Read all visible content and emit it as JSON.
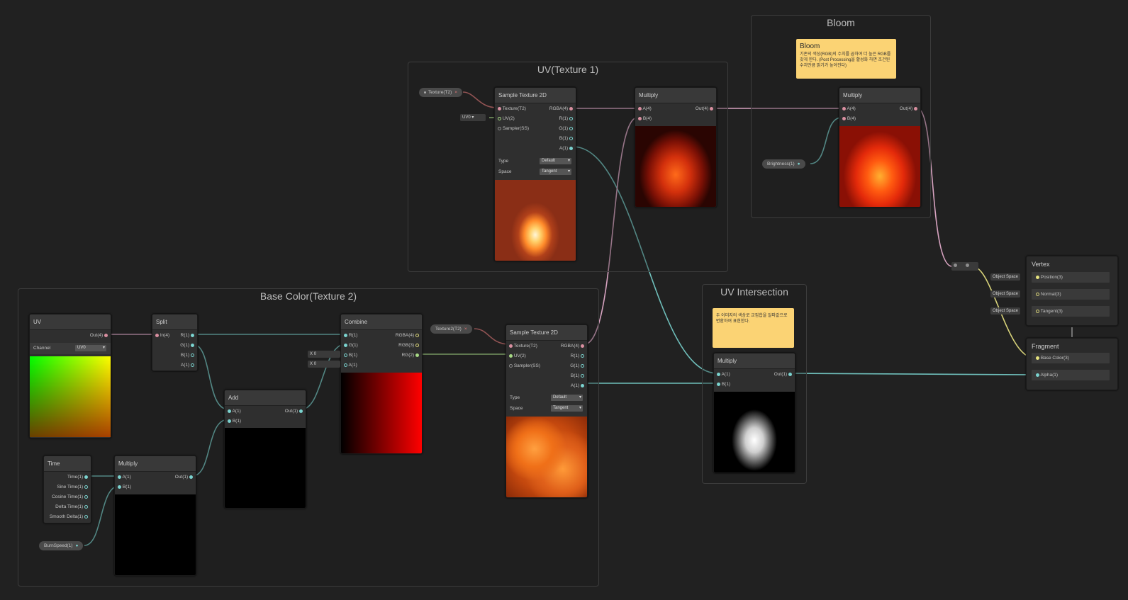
{
  "groups": {
    "uv_tex1": "UV(Texture 1)",
    "bloom": "Bloom",
    "base_color": "Base Color(Texture 2)",
    "uv_intersection": "UV Intersection"
  },
  "sticky_bloom": {
    "title": "Bloom",
    "text": "기존의 색상(RGB)의 수치를 곱하여 더 높은 RGB를 갖게 한다. (Post Processing을 활성화 하면 조건된 수치만큼 밝기가 높아진다)"
  },
  "sticky_uv": {
    "text": "두 이미지의 색상로 교집합을 알파값으로 변환하여 표현한다."
  },
  "props": {
    "texture1": "Texture(T2)",
    "texture2": "Texture2(T2)",
    "brightness": "Brightness(1)",
    "burn_speed": "BurnSpeed(1)",
    "uv0": "UV0"
  },
  "sample1": {
    "title": "Sample Texture 2D",
    "in_texture": "Texture(T2)",
    "in_uv": "UV(2)",
    "in_sampler": "Sampler(SS)",
    "out_rgba": "RGBA(4)",
    "out_r": "R(1)",
    "out_g": "G(1)",
    "out_b": "B(1)",
    "out_a": "A(1)",
    "type_label": "Type",
    "type_value": "Default",
    "space_label": "Space",
    "space_value": "Tangent"
  },
  "multiply1": {
    "title": "Multiply",
    "a": "A(4)",
    "b": "B(4)",
    "out": "Out(4)"
  },
  "multiply2": {
    "title": "Multiply",
    "a": "A(4)",
    "b": "B(4)",
    "out": "Out(4)"
  },
  "uv_node": {
    "title": "UV",
    "out": "Out(4)",
    "channel_label": "Channel",
    "channel_value": "UV0"
  },
  "split": {
    "title": "Split",
    "in": "In(4)",
    "r": "R(1)",
    "g": "G(1)",
    "b": "B(1)",
    "a": "A(1)"
  },
  "combine": {
    "title": "Combine",
    "r": "R(1)",
    "g": "G(1)",
    "b": "B(1)",
    "a": "A(1)",
    "rgba": "RGBA(4)",
    "rgb": "RGB(3)",
    "rg": "RG(2)",
    "b_default": "0",
    "a_default": "0",
    "x_label": "X"
  },
  "add": {
    "title": "Add",
    "a": "A(1)",
    "b": "B(1)",
    "out": "Out(1)"
  },
  "time": {
    "title": "Time",
    "time": "Time(1)",
    "sine": "Sine Time(1)",
    "cosine": "Cosine Time(1)",
    "delta": "Delta Time(1)",
    "smooth": "Smooth Delta(1)"
  },
  "multiply3": {
    "title": "Multiply",
    "a": "A(1)",
    "b": "B(1)",
    "out": "Out(1)"
  },
  "sample2": {
    "title": "Sample Texture 2D",
    "in_texture": "Texture(T2)",
    "in_uv": "UV(2)",
    "in_sampler": "Sampler(SS)",
    "out_rgba": "RGBA(4)",
    "out_r": "R(1)",
    "out_g": "G(1)",
    "out_b": "B(1)",
    "out_a": "A(1)",
    "type_label": "Type",
    "type_value": "Default",
    "space_label": "Space",
    "space_value": "Tangent"
  },
  "multiply4": {
    "title": "Multiply",
    "a": "A(1)",
    "b": "B(1)",
    "out": "Out(1)"
  },
  "vertex": {
    "title": "Vertex",
    "position": "Position(3)",
    "normal": "Normal(3)",
    "tangent": "Tangent(3)",
    "space": "Object Space"
  },
  "fragment": {
    "title": "Fragment",
    "base_color": "Base Color(3)",
    "alpha": "Alpha(1)"
  },
  "colors": {
    "background": "#212121",
    "wire_pink": "#d7a3c0",
    "wire_cyan": "#6fbfbb",
    "wire_green": "#a6d884",
    "wire_yellow": "#d9d47a",
    "sticky": "#fbd374"
  }
}
